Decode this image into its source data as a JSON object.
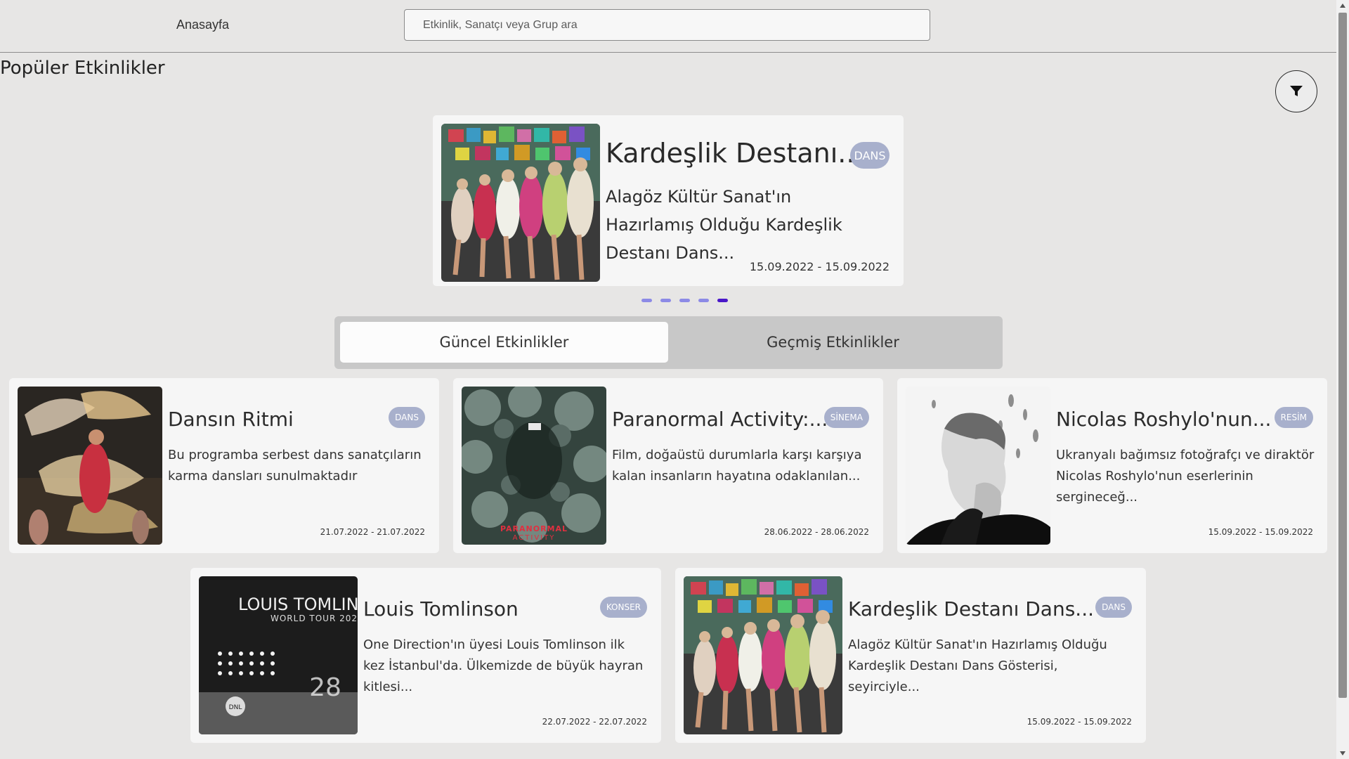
{
  "header": {
    "home_label": "Anasayfa",
    "search_placeholder": "Etkinlik, Sanatçı veya Grup ara"
  },
  "section_title": "Popüler Etkinlikler",
  "filter_icon": "filter-icon",
  "featured": {
    "title": "Kardeşlik Destanı...",
    "badge": "DANS",
    "description": "Alagöz Kültür Sanat'ın Hazırlamış Olduğu Kardeşlik Destanı Dans...",
    "date": "15.09.2022 - 15.09.2022",
    "slides_total": 5,
    "active_slide": 5
  },
  "tabs": {
    "current": "Güncel Etkinlikler",
    "past": "Geçmiş Etkinlikler"
  },
  "events": [
    {
      "title": "Dansın Ritmi",
      "badge": "DANS",
      "description": "Bu programba serbest dans sanatçıların karma dansları sunulmaktadır",
      "date": "21.07.2022 - 21.07.2022"
    },
    {
      "title": "Paranormal Activity:...",
      "badge": "SİNEMA",
      "description": "Film, doğaüstü durumlarla karşı karşıya kalan insanların hayatına odaklanılan...",
      "date": "28.06.2022 - 28.06.2022",
      "poster_text": "PARANORMAL ACTIVITY"
    },
    {
      "title": "Nicolas Roshylo'nun...",
      "badge": "RESİM",
      "description": "Ukranyalı bağımsız fotoğrafçı ve diraktör Nicolas Roshylo'nun eserlerinin sergineceğ...",
      "date": "15.09.2022 - 15.09.2022"
    },
    {
      "title": "Louis Tomlinson",
      "badge": "KONSER",
      "description": "One Direction'ın üyesi Louis Tomlinson ilk kez İstanbul'da. Ülkemizde de büyük hayran kitlesi...",
      "date": "22.07.2022 - 22.07.2022",
      "poster_title": "LOUIS TOMLIN",
      "poster_sub": "WORLD TOUR 202"
    },
    {
      "title": "Kardeşlik Destanı Dans...",
      "badge": "DANS",
      "description": "Alagöz Kültür Sanat'ın Hazırlamış Olduğu Kardeşlik Destanı Dans Gösterisi, seyirciyle...",
      "date": "15.09.2022 - 15.09.2022"
    }
  ],
  "colors": {
    "badge": "#a8b0cc",
    "dot": "#8c8ae6",
    "dot_active": "#4a18c9",
    "background": "#e7e6e5"
  }
}
